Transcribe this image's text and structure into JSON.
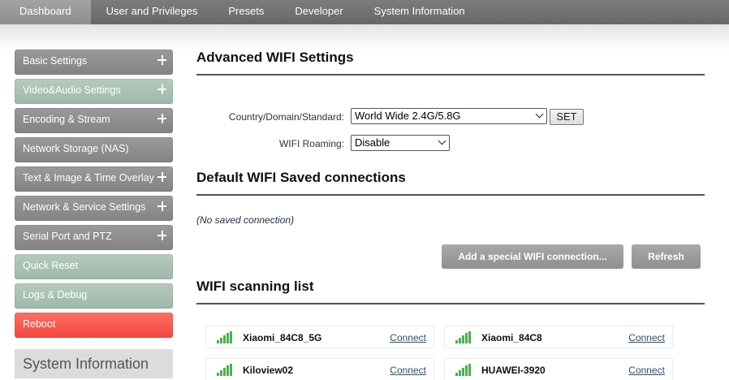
{
  "topnav": {
    "tabs": [
      {
        "label": "Dashboard",
        "active": true
      },
      {
        "label": "User and Privileges",
        "active": false
      },
      {
        "label": "Presets",
        "active": false
      },
      {
        "label": "Developer",
        "active": false
      },
      {
        "label": "System Information",
        "active": false
      }
    ]
  },
  "sidebar": {
    "items": [
      {
        "label": "Basic Settings",
        "style": "grey",
        "expandable": true
      },
      {
        "label": "Video&Audio Settings",
        "style": "green",
        "expandable": true
      },
      {
        "label": "Encoding & Stream",
        "style": "grey",
        "expandable": true
      },
      {
        "label": "Network Storage (NAS)",
        "style": "grey",
        "expandable": false
      },
      {
        "label": "Text & Image & Time Overlay",
        "style": "grey",
        "expandable": true
      },
      {
        "label": "Network & Service Settings",
        "style": "grey",
        "expandable": true
      },
      {
        "label": "Serial Port and PTZ",
        "style": "grey",
        "expandable": true
      },
      {
        "label": "Quick Reset",
        "style": "green",
        "expandable": false
      },
      {
        "label": "Logs & Debug",
        "style": "green",
        "expandable": false
      },
      {
        "label": "Reboot",
        "style": "red",
        "expandable": false
      }
    ],
    "info_box_title": "System Information"
  },
  "advanced": {
    "title": "Advanced WIFI Settings",
    "country_label": "Country/Domain/Standard:",
    "country_value": "World Wide 2.4G/5.8G",
    "set_label": "SET",
    "roaming_label": "WIFI Roaming:",
    "roaming_value": "Disable"
  },
  "saved": {
    "title": "Default WIFI Saved connections",
    "empty_text": "(No saved connection)",
    "add_button": "Add a special WIFI connection...",
    "refresh_button": "Refresh"
  },
  "scan": {
    "title": "WIFI scanning list",
    "connect_label": "Connect",
    "networks": [
      {
        "ssid": "Xiaomi_84C8_5G"
      },
      {
        "ssid": "Xiaomi_84C8"
      },
      {
        "ssid": "Kiloview02"
      },
      {
        "ssid": "HUAWEI-3920"
      }
    ]
  },
  "colors": {
    "nav": "#707070",
    "sidebar_grey": "#8e8e8e",
    "sidebar_green": "#a9c2b4",
    "sidebar_red": "#f6564a",
    "signal": "#4caf50"
  }
}
